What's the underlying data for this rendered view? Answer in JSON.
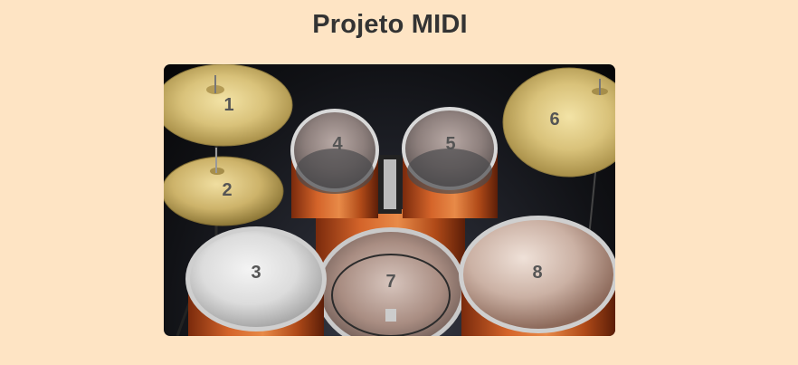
{
  "page": {
    "title": "Projeto MIDI"
  },
  "pads": [
    {
      "id": "pad-1",
      "label": "1",
      "instrument": "crash-cymbal-left"
    },
    {
      "id": "pad-2",
      "label": "2",
      "instrument": "hi-hat"
    },
    {
      "id": "pad-3",
      "label": "3",
      "instrument": "snare-drum"
    },
    {
      "id": "pad-4",
      "label": "4",
      "instrument": "tom-left"
    },
    {
      "id": "pad-5",
      "label": "5",
      "instrument": "tom-right"
    },
    {
      "id": "pad-6",
      "label": "6",
      "instrument": "ride-cymbal"
    },
    {
      "id": "pad-7",
      "label": "7",
      "instrument": "bass-drum"
    },
    {
      "id": "pad-8",
      "label": "8",
      "instrument": "floor-tom"
    }
  ],
  "colors": {
    "background": "#fee4c4",
    "title": "#333333",
    "pad_label": "#555555",
    "cymbal_gold": "#d9c27a",
    "drum_shell": "#c2541e"
  }
}
